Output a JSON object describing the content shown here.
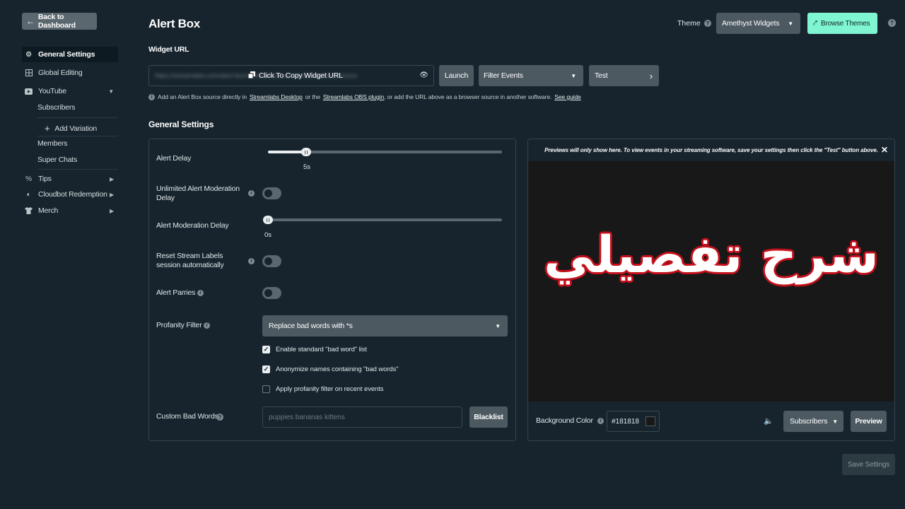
{
  "sidebar": {
    "back_label": "Back to Dashboard",
    "items": [
      {
        "label": "General Settings",
        "icon": "gear-icon"
      },
      {
        "label": "Global Editing",
        "icon": "grid-icon"
      },
      {
        "label": "YouTube",
        "icon": "youtube-icon"
      },
      {
        "label": "Tips",
        "icon": "tips-icon"
      },
      {
        "label": "Cloudbot Redemption",
        "icon": "cloudbot-icon"
      },
      {
        "label": "Merch",
        "icon": "shirt-icon"
      }
    ],
    "sub_items": [
      "Subscribers",
      "Add Variation",
      "Members",
      "Super Chats"
    ]
  },
  "header": {
    "title": "Alert Box",
    "theme_label": "Theme",
    "theme_value": "Amethyst Widgets",
    "browse_label": "Browse Themes"
  },
  "widget_url": {
    "label": "Widget URL",
    "blurred_url": "https://streamlabs.com/alert-box/v3/xxxxxxxxxxxxxxxxxxxxxxxxxxxxxxxx",
    "copy_label": "Click To Copy Widget URL",
    "launch_label": "Launch",
    "filter_label": "Filter Events",
    "test_label": "Test",
    "info_prefix": "Add an Alert Box source directly in",
    "link_desktop": "Streamlabs Desktop",
    "info_or": "or the",
    "link_plugin": "Streamlabs OBS plugin",
    "info_suffix": ", or add the URL above as a browser source in another software.",
    "link_guide": "See guide"
  },
  "general_settings": {
    "heading": "General Settings",
    "alert_delay_label": "Alert Delay",
    "alert_delay_value": "5s",
    "alert_delay_fraction": 0.16,
    "unlimited_label": "Unlimited Alert Moderation Delay",
    "moderation_delay_label": "Alert Moderation Delay",
    "moderation_delay_value": "0s",
    "moderation_delay_fraction": 0.0,
    "reset_label": "Reset Stream Labels session automatically",
    "parries_label": "Alert Parries",
    "profanity_label": "Profanity Filter",
    "profanity_value": "Replace bad words with *s",
    "checks": [
      {
        "label": "Enable standard \"bad word\" list",
        "checked": true
      },
      {
        "label": "Anonymize names containing \"bad words\"",
        "checked": true
      },
      {
        "label": "Apply profanity filter on recent events",
        "checked": false
      }
    ],
    "custom_label": "Custom Bad Words",
    "custom_placeholder": "puppies bananas kittens",
    "blacklist_label": "Blacklist"
  },
  "preview": {
    "note": "Previews will only show here. To view events in your streaming software, save your settings then click the \"Test\" button above.",
    "overlay_text": "شرح تفصيلي",
    "bg_label": "Background Color",
    "bg_value": "#181818",
    "event_value": "Subscribers",
    "preview_label": "Preview"
  },
  "save_label": "Save Settings",
  "colors": {
    "accent": "#80f5d2",
    "background": "#17242d",
    "overlay_outline": "#c4101c"
  }
}
